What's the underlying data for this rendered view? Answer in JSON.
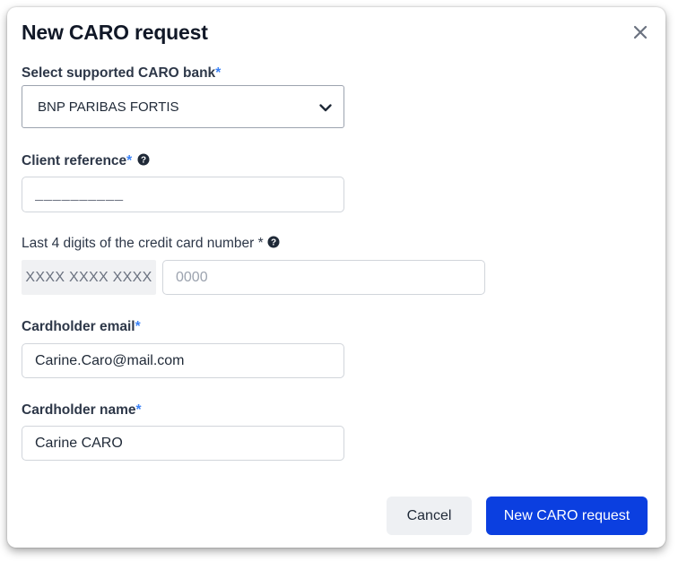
{
  "dialog": {
    "title": "New CARO request",
    "close_icon": "close-icon"
  },
  "fields": {
    "bank": {
      "label": "Select supported CARO bank",
      "required_mark": "*",
      "selected_value": "BNP PARIBAS FORTIS",
      "icon": "chevron-down-icon"
    },
    "client_reference": {
      "label": "Client reference",
      "required_mark": "*",
      "help_icon": "question-circle-icon",
      "value": "",
      "placeholder": "__________"
    },
    "card_digits": {
      "label": "Last 4 digits of the credit card number *",
      "help_icon": "question-circle-icon",
      "prefix": "XXXX XXXX XXXX",
      "value": "",
      "placeholder": "0000"
    },
    "cardholder_email": {
      "label": "Cardholder email",
      "required_mark": "*",
      "value": "Carine.Caro@mail.com"
    },
    "cardholder_name": {
      "label": "Cardholder name",
      "required_mark": "*",
      "value": "Carine CARO"
    }
  },
  "actions": {
    "cancel_label": "Cancel",
    "submit_label": "New CARO request"
  },
  "colors": {
    "primary": "#0b3fe0",
    "required_mark": "#3b82f6",
    "cancel_bg": "#eef0f3"
  }
}
